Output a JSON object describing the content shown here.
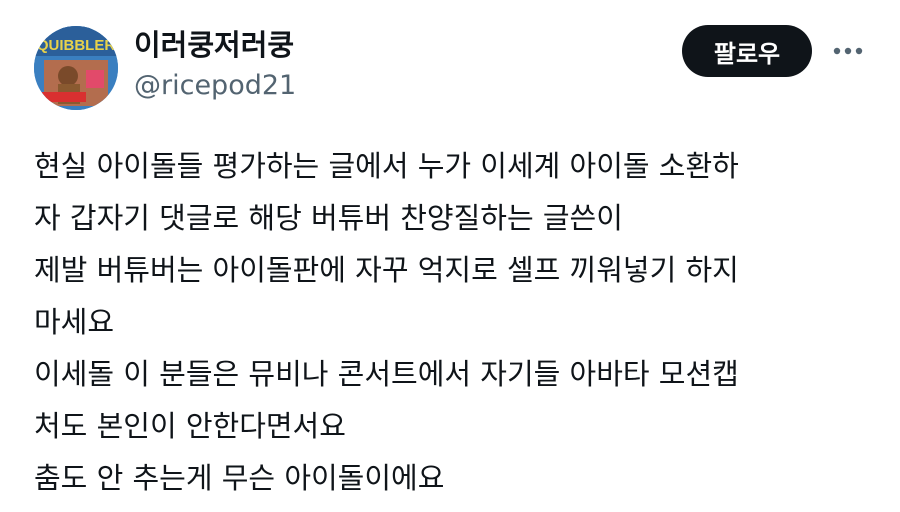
{
  "user": {
    "display_name": "이러쿵저러쿵",
    "handle": "@ricepod21",
    "avatar_icon": "avatar-image",
    "avatar_logo_text": "QUIBBLER"
  },
  "actions": {
    "follow_label": "팔로우",
    "more_icon": "more-options-icon"
  },
  "tweet": {
    "lines": [
      "현실 아이돌들 평가하는 글에서 누가 이세계 아이돌 소환하",
      "자 갑자기 댓글로 해당 버튜버 찬양질하는 글쓴이",
      "제발 버튜버는 아이돌판에 자꾸 억지로 셀프 끼워넣기 하지",
      "마세요",
      "이세돌 이 분들은 뮤비나 콘서트에서 자기들 아바타 모션캡",
      "처도 본인이 안한다면서요",
      "춤도 안 추는게 무슨 아이돌이에요"
    ]
  },
  "colors": {
    "text": "#0f1419",
    "secondary_text": "#536471",
    "button_bg": "#0f1419",
    "button_text": "#ffffff"
  }
}
